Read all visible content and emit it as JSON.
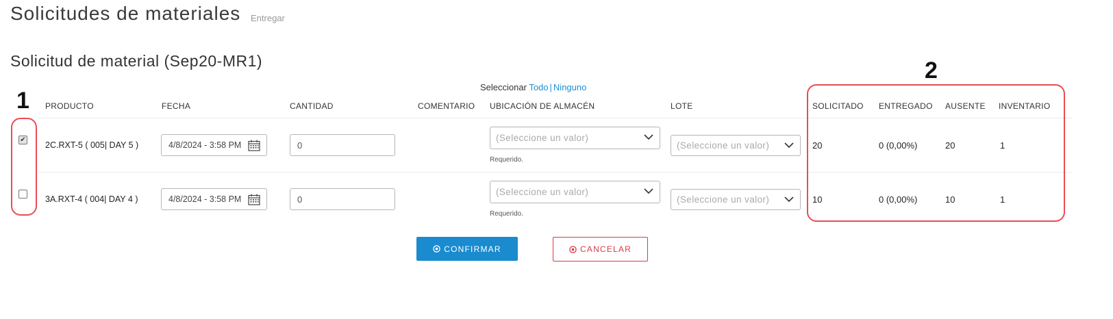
{
  "header": {
    "title": "Solicitudes de materiales",
    "subtitle": "Entregar"
  },
  "section": {
    "title": "Solicitud de material (Sep20-MR1)"
  },
  "select_controls": {
    "label": "Seleccionar",
    "all": "Todo",
    "separator": "|",
    "none": "Ninguno"
  },
  "columns": {
    "producto": "PRODUCTO",
    "fecha": "FECHA",
    "cantidad": "CANTIDAD",
    "comentario": "COMENTARIO",
    "ubicacion": "UBICACIÓN DE ALMACÉN",
    "lote": "LOTE",
    "solicitado": "SOLICITADO",
    "entregado": "ENTREGADO",
    "ausente": "AUSENTE",
    "inventario": "INVENTARIO"
  },
  "rows": [
    {
      "checked": true,
      "producto": "2C.RXT-5 ( 005| DAY 5 )",
      "fecha": "4/8/2024 - 3:58 PM",
      "cantidad": "0",
      "ubicacion_placeholder": "(Seleccione un valor)",
      "ubicacion_required": "Requerido.",
      "lote_placeholder": "(Seleccione un valor)",
      "solicitado": "20",
      "entregado": "0 (0,00%)",
      "ausente": "20",
      "inventario": "1"
    },
    {
      "checked": false,
      "producto": "3A.RXT-4 ( 004| DAY 4 )",
      "fecha": "4/8/2024 - 3:58 PM",
      "cantidad": "0",
      "ubicacion_placeholder": "(Seleccione un valor)",
      "ubicacion_required": "Requerido.",
      "lote_placeholder": "(Seleccione un valor)",
      "solicitado": "10",
      "entregado": "0 (0,00%)",
      "ausente": "10",
      "inventario": "1"
    }
  ],
  "buttons": {
    "confirm": "CONFIRMAR",
    "cancel": "CANCELAR"
  },
  "annotations": {
    "marker_1": "1",
    "marker_2": "2",
    "color": "#e84c55"
  },
  "colors": {
    "link": "#1c8fd3",
    "primary": "#1a8bcf",
    "danger": "#d83a44"
  },
  "icons": {
    "calendar": "calendar-icon",
    "dropdown": "chevron-down-icon",
    "confirm": "check-circle-icon",
    "cancel": "x-circle-icon"
  }
}
